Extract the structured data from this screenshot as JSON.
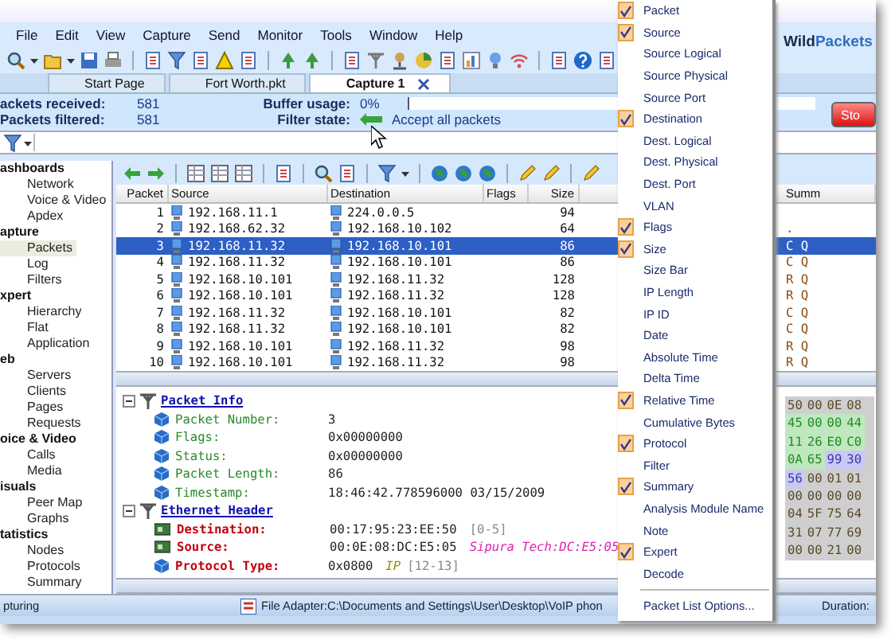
{
  "menu_bar": [
    "File",
    "Edit",
    "View",
    "Capture",
    "Send",
    "Monitor",
    "Tools",
    "Window",
    "Help"
  ],
  "logo": {
    "first": "Wild",
    "second": "Packets"
  },
  "tabs": [
    {
      "label": "Start Page",
      "selected": false,
      "closable": false
    },
    {
      "label": "Fort Worth.pkt",
      "selected": false,
      "closable": false
    },
    {
      "label": "Capture 1",
      "selected": true,
      "closable": true
    }
  ],
  "stats": [
    {
      "label": "ackets received:",
      "value": "581"
    },
    {
      "label": "Packets filtered:",
      "value": "581"
    }
  ],
  "buffer_usage": {
    "label": "Buffer usage:",
    "value": "0%"
  },
  "filter_state": {
    "label": "Filter state:",
    "value": "Accept all packets"
  },
  "stop_button": "Sto",
  "nav": [
    {
      "label": "ashboards",
      "children": [
        {
          "label": "Network",
          "selected": false
        },
        {
          "label": "Voice & Video",
          "selected": false
        },
        {
          "label": "Apdex",
          "selected": false
        }
      ]
    },
    {
      "label": "apture",
      "children": [
        {
          "label": "Packets",
          "selected": true
        },
        {
          "label": "Log",
          "selected": false
        },
        {
          "label": "Filters",
          "selected": false
        }
      ]
    },
    {
      "label": "xpert",
      "children": [
        {
          "label": "Hierarchy",
          "selected": false
        },
        {
          "label": "Flat",
          "selected": false
        },
        {
          "label": "Application",
          "selected": false
        }
      ]
    },
    {
      "label": "eb",
      "children": [
        {
          "label": "Servers",
          "selected": false
        },
        {
          "label": "Clients",
          "selected": false
        },
        {
          "label": "Pages",
          "selected": false
        },
        {
          "label": "Requests",
          "selected": false
        }
      ]
    },
    {
      "label": "oice & Video",
      "children": [
        {
          "label": "Calls",
          "selected": false
        },
        {
          "label": "Media",
          "selected": false
        }
      ]
    },
    {
      "label": "isuals",
      "children": [
        {
          "label": "Peer Map",
          "selected": false
        },
        {
          "label": "Graphs",
          "selected": false
        }
      ]
    },
    {
      "label": "tatistics",
      "children": [
        {
          "label": "Nodes",
          "selected": false
        },
        {
          "label": "Protocols",
          "selected": false
        },
        {
          "label": "Summary",
          "selected": false
        }
      ]
    }
  ],
  "packet_list": {
    "columns": [
      "Packet",
      "Source",
      "Destination",
      "Flags",
      "Size",
      "Summ"
    ],
    "rows": [
      {
        "packet": "1",
        "source": "192.168.11.1",
        "destination": "224.0.0.5",
        "size": "94",
        "selected": false
      },
      {
        "packet": "2",
        "source": "192.168.62.32",
        "destination": "192.168.10.102",
        "size": "64",
        "summary": ".",
        "selected": false
      },
      {
        "packet": "3",
        "source": "192.168.11.32",
        "destination": "192.168.10.101",
        "size": "86",
        "summary": "C Q",
        "selected": true
      },
      {
        "packet": "4",
        "source": "192.168.11.32",
        "destination": "192.168.10.101",
        "size": "86",
        "summary": "C Q",
        "selected": false
      },
      {
        "packet": "5",
        "source": "192.168.10.101",
        "destination": "192.168.11.32",
        "size": "128",
        "summary": "R Q",
        "selected": false
      },
      {
        "packet": "6",
        "source": "192.168.10.101",
        "destination": "192.168.11.32",
        "size": "128",
        "summary": "R Q",
        "selected": false
      },
      {
        "packet": "7",
        "source": "192.168.11.32",
        "destination": "192.168.10.101",
        "size": "82",
        "summary": "C Q",
        "selected": false
      },
      {
        "packet": "8",
        "source": "192.168.11.32",
        "destination": "192.168.10.101",
        "size": "82",
        "summary": "C Q",
        "selected": false
      },
      {
        "packet": "9",
        "source": "192.168.10.101",
        "destination": "192.168.11.32",
        "size": "98",
        "summary": "R Q",
        "selected": false
      },
      {
        "packet": "10",
        "source": "192.168.10.101",
        "destination": "192.168.11.32",
        "size": "98",
        "summary": "R Q",
        "selected": false
      }
    ]
  },
  "decode": [
    {
      "title": "Packet Info",
      "expanded": true,
      "fields": [
        {
          "kind": "info",
          "label": "Packet Number:",
          "value": "3"
        },
        {
          "kind": "info",
          "label": "Flags:",
          "value": "0x00000000"
        },
        {
          "kind": "info",
          "label": "Status:",
          "value": "0x00000000"
        },
        {
          "kind": "info",
          "label": "Packet Length:",
          "value": "86"
        },
        {
          "kind": "info",
          "label": "Timestamp:",
          "value": "18:46:42.778596000 03/15/2009"
        }
      ]
    },
    {
      "title": "Ethernet Header",
      "expanded": true,
      "fields": [
        {
          "kind": "address",
          "label": "Destination:",
          "value": "00:17:95:23:EE:50",
          "range": "[0-5]"
        },
        {
          "kind": "address",
          "label": "Source:",
          "value": "00:0E:08:DC:E5:05",
          "note": {
            "kind": "vendor",
            "text": "Sipura Tech:DC:E5:05"
          }
        },
        {
          "kind": "field",
          "label": "Protocol Type:",
          "value": "0x0800",
          "note": {
            "kind": "protocol",
            "text": "IP"
          },
          "range": "[12-13]"
        }
      ]
    }
  ],
  "hex": [
    [
      {
        "b": "50",
        "kind": "plain"
      },
      {
        "b": "00",
        "kind": "plain"
      },
      {
        "b": "0E",
        "kind": "plain"
      },
      {
        "b": "08",
        "kind": "plain"
      }
    ],
    [
      {
        "b": "45",
        "kind": "ip"
      },
      {
        "b": "00",
        "kind": "ip"
      },
      {
        "b": "00",
        "kind": "ip"
      },
      {
        "b": "44",
        "kind": "ip"
      }
    ],
    [
      {
        "b": "11",
        "kind": "ip"
      },
      {
        "b": "26",
        "kind": "ip"
      },
      {
        "b": "E0",
        "kind": "ip"
      },
      {
        "b": "C0",
        "kind": "ip"
      }
    ],
    [
      {
        "b": "0A",
        "kind": "ip"
      },
      {
        "b": "65",
        "kind": "ip"
      },
      {
        "b": "99",
        "kind": "udp"
      },
      {
        "b": "30",
        "kind": "udp"
      }
    ],
    [
      {
        "b": "56",
        "kind": "udp"
      },
      {
        "b": "00",
        "kind": "plain"
      },
      {
        "b": "01",
        "kind": "plain"
      },
      {
        "b": "01",
        "kind": "plain"
      }
    ],
    [
      {
        "b": "00",
        "kind": "plain"
      },
      {
        "b": "00",
        "kind": "plain"
      },
      {
        "b": "00",
        "kind": "plain"
      },
      {
        "b": "00",
        "kind": "plain"
      }
    ],
    [
      {
        "b": "04",
        "kind": "plain"
      },
      {
        "b": "5F",
        "kind": "plain"
      },
      {
        "b": "75",
        "kind": "plain"
      },
      {
        "b": "64",
        "kind": "plain"
      }
    ],
    [
      {
        "b": "31",
        "kind": "plain"
      },
      {
        "b": "07",
        "kind": "plain"
      },
      {
        "b": "77",
        "kind": "plain"
      },
      {
        "b": "69",
        "kind": "plain"
      }
    ],
    [
      {
        "b": "00",
        "kind": "plain"
      },
      {
        "b": "00",
        "kind": "plain"
      },
      {
        "b": "21",
        "kind": "plain"
      },
      {
        "b": "00",
        "kind": "plain"
      }
    ]
  ],
  "status_bar": {
    "state": "pturing",
    "file": "File Adapter:C:\\Documents and Settings\\User\\Desktop\\VoIP phon",
    "duration": "Duration:"
  },
  "column_menu": {
    "items": [
      {
        "label": "Packet",
        "checked": true
      },
      {
        "label": "Source",
        "checked": true
      },
      {
        "label": "Source Logical",
        "checked": false
      },
      {
        "label": "Source Physical",
        "checked": false
      },
      {
        "label": "Source Port",
        "checked": false
      },
      {
        "label": "Destination",
        "checked": true
      },
      {
        "label": "Dest. Logical",
        "checked": false
      },
      {
        "label": "Dest. Physical",
        "checked": false
      },
      {
        "label": "Dest. Port",
        "checked": false
      },
      {
        "label": "VLAN",
        "checked": false
      },
      {
        "label": "Flags",
        "checked": true
      },
      {
        "label": "Size",
        "checked": true
      },
      {
        "label": "Size Bar",
        "checked": false
      },
      {
        "label": "IP Length",
        "checked": false
      },
      {
        "label": "IP ID",
        "checked": false
      },
      {
        "label": "Date",
        "checked": false
      },
      {
        "label": "Absolute Time",
        "checked": false
      },
      {
        "label": "Delta Time",
        "checked": false
      },
      {
        "label": "Relative Time",
        "checked": true
      },
      {
        "label": "Cumulative Bytes",
        "checked": false
      },
      {
        "label": "Protocol",
        "checked": true
      },
      {
        "label": "Filter",
        "checked": false
      },
      {
        "label": "Summary",
        "checked": true
      },
      {
        "label": "Analysis Module Name",
        "checked": false
      },
      {
        "label": "Note",
        "checked": false
      },
      {
        "label": "Expert",
        "checked": true
      },
      {
        "label": "Decode",
        "checked": false
      }
    ],
    "footer": "Packet List Options..."
  }
}
